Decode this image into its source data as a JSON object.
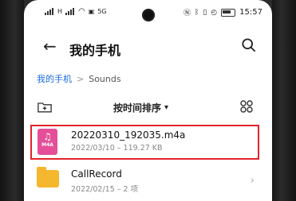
{
  "status": {
    "time": "15:57",
    "left_indicators": [
      "H",
      "5G"
    ]
  },
  "header": {
    "title": "我的手机"
  },
  "breadcrumb": {
    "root": "我的手机",
    "separator": ">",
    "current": "Sounds"
  },
  "toolbar": {
    "sort_label": "按时间排序",
    "sort_arrow": "▾"
  },
  "files": [
    {
      "name": "20220310_192035.m4a",
      "meta": "2022/03/10 – 119.27 KB",
      "icon": "m4a-file-icon",
      "icon_text": "M4A",
      "selected": true
    },
    {
      "name": "CallRecord",
      "meta": "2022/02/15 – 2 项",
      "icon": "folder-icon"
    }
  ],
  "colors": {
    "accent": "#1a6ce0",
    "highlight": "#e2232b",
    "audio_icon": "#e54f9a",
    "folder": "#f4b72e"
  }
}
